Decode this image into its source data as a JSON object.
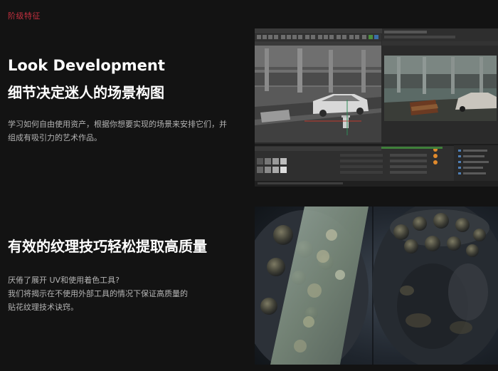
{
  "section_tag": "阶级特征",
  "feature1": {
    "title_en": "Look Development",
    "title_cn": "细节决定迷人的场景构图",
    "desc_lines": [
      "学习如何自由使用资产，根据你想要实现的场景来安排它们，并",
      "组成有吸引力的艺术作品。"
    ]
  },
  "feature2": {
    "title": "有效的纹理技巧轻松提取高质量",
    "desc_lines": [
      "厌倦了展开 UV和使用着色工具?",
      "我们将揭示在不使用外部工具的情况下保证高质量的",
      "贴花纹理技术诀窍。"
    ]
  },
  "colors": {
    "background": "#131313",
    "accent": "#c4303f",
    "heading": "#ffffff",
    "body_text": "#b4b4b4"
  }
}
